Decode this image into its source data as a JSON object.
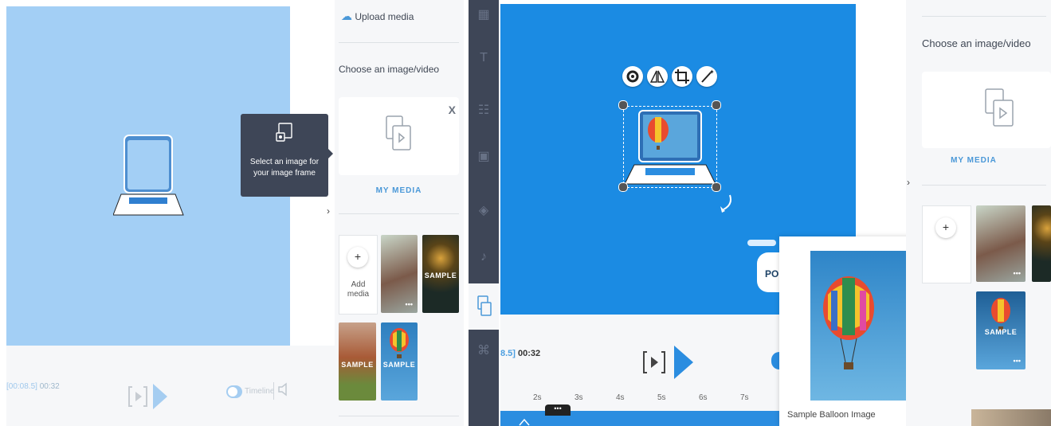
{
  "left": {
    "player": {
      "current_time": "00:08.5",
      "total_time": "00:32",
      "timeline_label": "Timeline"
    },
    "tooltip": {
      "text": "Select an image for your image frame"
    },
    "sidebar": {
      "upload_label": "Upload media",
      "choose_label": "Choose an image/video",
      "close_label": "X",
      "my_media_label": "MY MEDIA",
      "add_media_label": "Add media",
      "thumbs": [
        {
          "name": "squirrel",
          "sample": "",
          "dots": "•••"
        },
        {
          "name": "sparkler",
          "sample": "SAMPLE",
          "dots": ""
        },
        {
          "name": "puppy",
          "sample": "SAMPLE",
          "dots": ""
        },
        {
          "name": "balloon",
          "sample": "SAMPLE",
          "dots": ""
        }
      ]
    }
  },
  "right": {
    "player": {
      "current_time": "8.5]",
      "total_time": "00:32"
    },
    "timeline_ticks": [
      "2s",
      "3s",
      "4s",
      "5s",
      "6s",
      "7s"
    ],
    "popup": {
      "image_name": "Sample Balloon Image"
    },
    "sidebar": {
      "choose_label": "Choose an image/video",
      "my_media_label": "MY MEDIA",
      "add_symbol": "+",
      "sample_label": "SAMPLE",
      "dots": "•••"
    },
    "partial_text": {
      "po": "PO"
    }
  },
  "colors": {
    "canvas_light": "#a3cff5",
    "canvas_blue": "#1b8be3",
    "accent": "#4a98d8",
    "toolbar": "#3e4657"
  }
}
